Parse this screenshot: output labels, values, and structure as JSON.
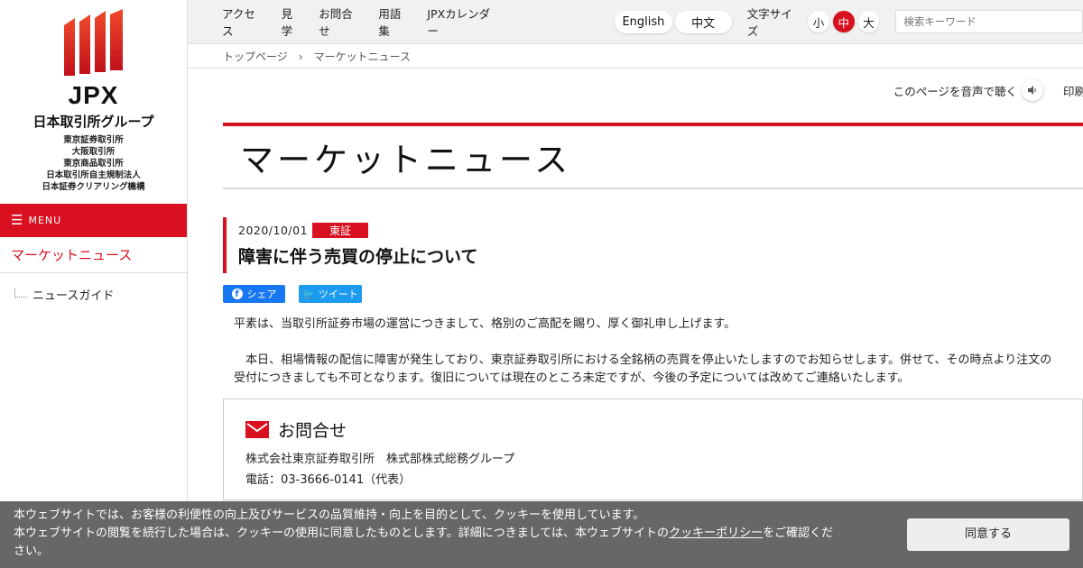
{
  "brand": {
    "logo_text": "JPX",
    "name": "日本取引所グループ",
    "subsidiaries": [
      "東京証券取引所",
      "大阪取引所",
      "東京商品取引所",
      "日本取引所自主規制法人",
      "日本証券クリアリング機構"
    ],
    "accent_color": "#d8101f"
  },
  "sidebar": {
    "menu_label": "MENU",
    "current": "マーケットニュース",
    "items": [
      {
        "label": "ニュースガイド"
      }
    ]
  },
  "topnav": {
    "links": [
      "アクセス",
      "見学",
      "お問合せ",
      "用語集",
      "JPXカレンダー"
    ],
    "lang_en": "English",
    "lang_zh": "中文",
    "font_size_label": "文字サイズ",
    "font_sizes": [
      "小",
      "中",
      "大"
    ],
    "font_size_selected": "中",
    "search_placeholder": "検索キーワード"
  },
  "breadcrumb": {
    "home": "トップページ",
    "separator": "›",
    "current": "マーケットニュース"
  },
  "tools": {
    "listen_label": "このページを音声で聴く",
    "print_label": "印刷"
  },
  "page": {
    "title": "マーケットニュース"
  },
  "news": {
    "date": "2020/10/01",
    "badge": "東証",
    "title": "障害に伴う売買の停止について",
    "share_fb": "シェア",
    "share_tw": "ツイート",
    "paragraph1": "平素は、当取引所証券市場の運営につきまして、格別のご高配を賜り、厚く御礼申し上げます。",
    "paragraph2_line1": "本日、相場情報の配信に障害が発生しており、東京証券取引所における全銘柄の売買を停止いたしますのでお知らせします。併せて、その時点より注文の",
    "paragraph2_line2": "受付につきましても不可となります。復旧については現在のところ未定ですが、今後の予定については改めてご連絡いたします。"
  },
  "contact": {
    "title": "お問合せ",
    "org": "株式会社東京証券取引所　株式部株式総務グループ",
    "phone": "電話：03-3666-0141（代表）"
  },
  "cookie": {
    "line1": "本ウェブサイトでは、お客様の利便性の向上及びサービスの品質維持・向上を目的として、クッキーを使用しています。",
    "line2_pre": "本ウェブサイトの閲覧を続行した場合は、クッキーの使用に同意したものとします。詳細につきましては、本ウェブサイトの",
    "policy_link": "クッキーポリシー",
    "line2_post": "をご確認くだ",
    "line3": "さい。",
    "agree_label": "同意する"
  }
}
